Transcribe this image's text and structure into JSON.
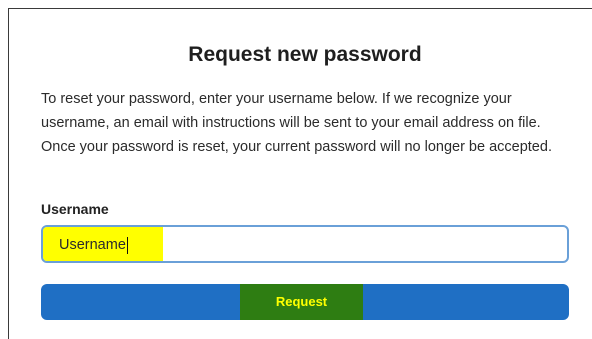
{
  "dialog": {
    "title": "Request new password",
    "description": "To reset your password, enter your username below. If we recognize your username, an email with instructions will be sent to your email address on file. Once your password is reset, your current password will no longer be accepted."
  },
  "form": {
    "username_label": "Username",
    "username_value": "Username",
    "username_placeholder": "Username",
    "submit_label": "Request"
  },
  "colors": {
    "button_blue": "#1f6fc4",
    "input_border": "#6aa0d8",
    "highlight_yellow": "#ffff00",
    "highlight_green": "#2e7d12"
  }
}
